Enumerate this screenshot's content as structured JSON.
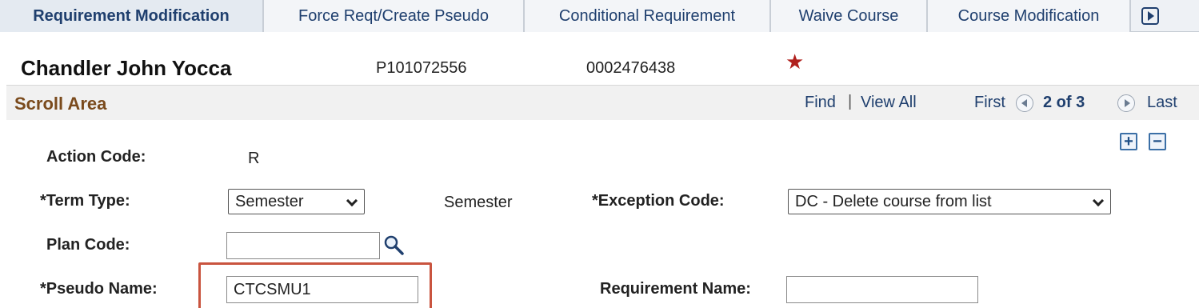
{
  "tabs": [
    {
      "label": "Requirement Modification",
      "active": true
    },
    {
      "label": "Force Reqt/Create Pseudo",
      "active": false
    },
    {
      "label": "Conditional Requirement",
      "active": false
    },
    {
      "label": "Waive Course",
      "active": false
    },
    {
      "label": "Course Modification",
      "active": false
    }
  ],
  "header": {
    "student_name": "Chandler John Yocca",
    "id_number": "P101072556",
    "emplid": "0002476438",
    "star_icon": "star-icon"
  },
  "scroll_area": {
    "title": "Scroll Area",
    "find": "Find",
    "separator": "|",
    "view_all": "View All",
    "first": "First",
    "position": "2 of 3",
    "last": "Last"
  },
  "form": {
    "action_code_label": "Action Code:",
    "action_code_value": "R",
    "term_type_label": "*Term Type:",
    "term_type_selected": "Semester",
    "term_type_desc": "Semester",
    "exception_code_label": "*Exception Code:",
    "exception_code_selected": "DC - Delete course from list",
    "plan_code_label": "Plan Code:",
    "plan_code_value": "",
    "pseudo_name_label": "*Pseudo Name:",
    "pseudo_name_value": "CTCSMU1",
    "requirement_name_label": "Requirement Name:",
    "requirement_name_value": ""
  },
  "colors": {
    "tab_text": "#1f3f6e",
    "scroll_title": "#7a4a1c",
    "star": "#b0201d",
    "highlight": "#c9543f"
  }
}
